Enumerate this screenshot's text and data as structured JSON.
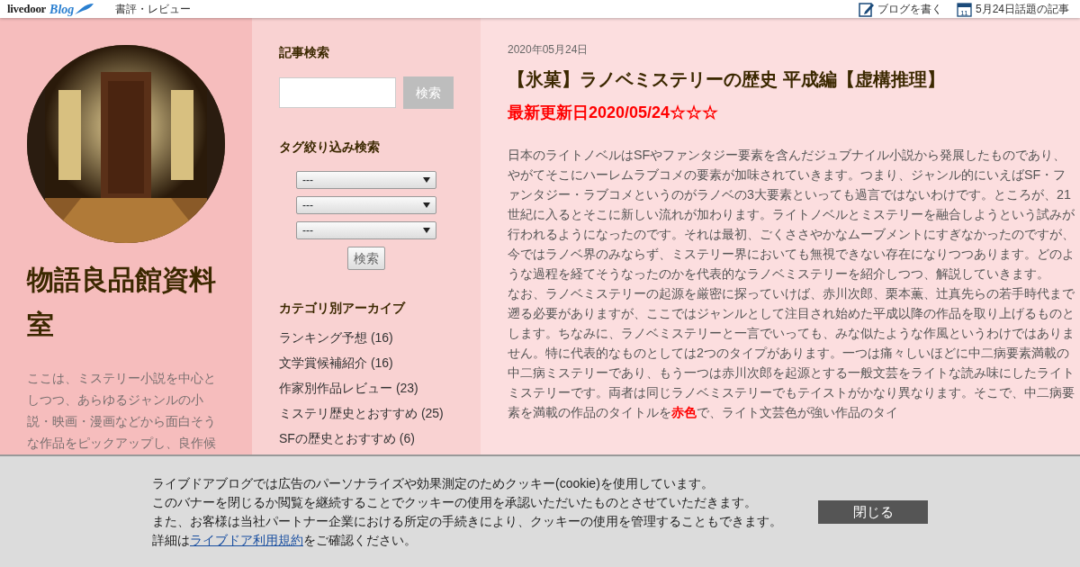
{
  "topbar": {
    "logo_main": "livedoor",
    "logo_sub": "Blog",
    "category": "書評・レビュー",
    "links": [
      {
        "kind": "write",
        "label": "ブログを書く"
      },
      {
        "kind": "calendar",
        "label": "5月24日話題の記事",
        "day": "11"
      }
    ]
  },
  "profile": {
    "kind": "picture",
    "title": "物語良品館資料室",
    "description": "ここは、ミステリー小説を中心としつつ、あらゆるジャンルの小説・映画・漫画などから面白そうな作品をピックアップし、良作候"
  },
  "search": {
    "heading": "記事検索",
    "button": "検索"
  },
  "tag_search": {
    "heading": "タグ絞り込み検索",
    "selects": [
      "---",
      "---",
      "---"
    ],
    "button": "検索"
  },
  "archive": {
    "heading": "カテゴリ別アーカイブ",
    "items": [
      "ランキング予想 (16)",
      "文学賞候補紹介 (16)",
      "作家別作品レビュー (23)",
      "ミステリ歴史とおすすめ (25)",
      "SFの歴史とおすすめ (6)"
    ]
  },
  "article": {
    "date": "2020年05月24日",
    "title": "【氷菓】ラノベミステリーの歴史 平成編【虚構推理】",
    "updated": "最新更新日2020/05/24☆☆☆",
    "paragraphs": [
      [
        {
          "text": "日本のライトノベルはSFやファンタジー要素を含んだジュブナイル小説から発展したものであり、やがてそこにハーレムラブコメの要素が加味されていきます。つまり、ジャンル的にいえばSF・ファンタジー・ラブコメというのがラノベの3大要素といっても過言ではないわけです。ところが、21世紀に入るとそこに新しい流れが加わります。ライトノベルとミステリーを融合しようという試みが行われるようになったのです。それは最初、ごくささやかなムーブメントにすぎなかったのですが、今ではラノベ界のみならず、ミステリー界においても無視できない存在になりつつあります。どのような過程を経てそうなったのかを代表的なラノベミステリーを紹介しつつ、解説していきます。"
        }
      ],
      [
        {
          "text": "なお、ラノベミステリーの起源を厳密に探っていけば、赤川次郎、栗本薫、辻真先らの若手時代まで遡る必要がありますが、ここではジャンルとして注目され始めた平成以降の作品を取り上げるものとします。ちなみに、ラノベミステリーと一言でいっても、みな似たような作風というわけではありません。特に代表的なものとしては2つのタイプがあります。一つは痛々しいほどに中二病要素満載の中二病ミステリーであり、もう一つは赤川次郎を起源とする一般文芸をライトな読み味にしたライトミステリーです。両者は同じラノベミステリーでもテイストがかなり異なります。そこで、中二病要素を満載の作品のタイトルを"
        },
        {
          "text": "赤色",
          "color": "#ff0000"
        },
        {
          "text": "で、ライト文芸色が強い作品のタイ"
        }
      ]
    ]
  },
  "cookie_banner": {
    "lines": [
      "ライブドアブログでは広告のパーソナライズや効果測定のためクッキー(cookie)を使用しています。",
      "このバナーを閉じるか閲覧を継続することでクッキーの使用を承認いただいたものとさせていただきます。",
      "また、お客様は当社パートナー企業における所定の手続きにより、クッキーの使用を管理することもできます。"
    ],
    "last_prefix": "詳細は",
    "link": "ライブドア利用規約",
    "last_suffix": "をご確認ください。",
    "close_button": "閉じる"
  }
}
